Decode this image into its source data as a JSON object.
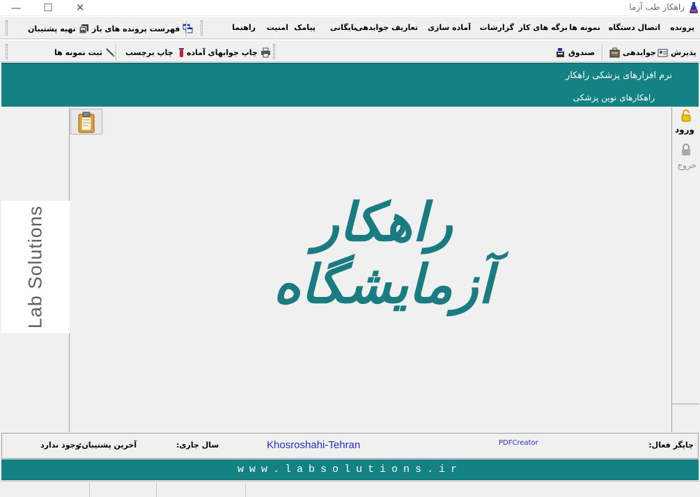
{
  "window": {
    "title": "راهکار طب آزما",
    "controls": [
      "—",
      "☐",
      "✕"
    ]
  },
  "menu": {
    "items": [
      "پرونده",
      "اتصال دستگاه",
      "نمونه ها",
      "برگه های کار",
      "گزارشات",
      "آماده سازی",
      "تعاریف جوابدهی",
      "بایگانی",
      "پیامک",
      "امنیت",
      "راهنما"
    ],
    "open_files_list": "فهرست پرونده های باز",
    "backup": "تهیه پشتیبان"
  },
  "toolbar": {
    "reception": "پذیرش",
    "answering": "جوابدهی",
    "cashbox": "صندوق",
    "print_ready_results": "چاپ جوابهای آماده",
    "print_label": "چاپ برچسب",
    "register_samples": "ثبت نمونه ها"
  },
  "header": {
    "line1": "نرم افزارهای پزشکی راهکار",
    "line2": "راهکارهای نوین پزشکی"
  },
  "side": {
    "login": "ورود",
    "logout": "خروج"
  },
  "logo_text": "Lab Solutions",
  "brand_title": "راهکار آزمایشگاه",
  "status": {
    "printer_label": "چاپگر فعال:",
    "printer_value": "PDFCreator",
    "location": "Khosroshahi-Tehran",
    "year_label": "سال جاری:",
    "backup_label": "آخرین پشتیبان:",
    "backup_value": "وجود ندارد"
  },
  "footer": {
    "url": "www.labsolutions.ir"
  },
  "colors": {
    "teal": "#148282",
    "brand_text": "#1a7b80",
    "status_blue": "#1f2ecc"
  }
}
